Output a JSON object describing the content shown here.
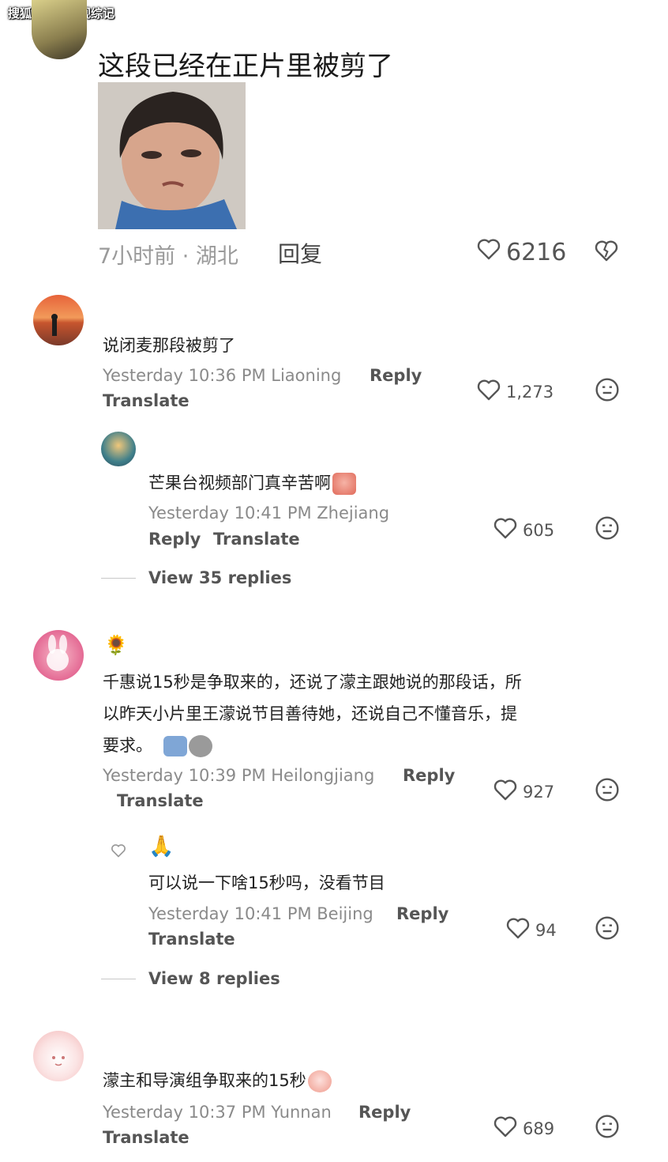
{
  "watermark": "搜狐号@子夜观综记",
  "top_post": {
    "text": "这段已经在正片里被剪了",
    "meta": "7小时前 · 湖北",
    "reply_label": "回复",
    "likes": "6216"
  },
  "comments": [
    {
      "text": "说闭麦那段被剪了",
      "meta": "Yesterday 10:36 PM Liaoning",
      "reply_label": "Reply",
      "translate_label": "Translate",
      "likes": "1,273"
    },
    {
      "text": "芒果台视频部门真辛苦啊",
      "meta": "Yesterday 10:41 PM Zhejiang",
      "reply_label": "Reply",
      "translate_label": "Translate",
      "likes": "605",
      "view_replies": "View 35 replies"
    },
    {
      "name_emoji": "🌻",
      "lines": [
        "千惠说15秒是争取来的，还说了濛主跟她说的那段话，所",
        "以昨天小片里王濛说节目善待她，还说自己不懂音乐，提",
        "要求。"
      ],
      "meta": "Yesterday 10:39 PM Heilongjiang",
      "reply_label": "Reply",
      "translate_label": "Translate",
      "likes": "927"
    },
    {
      "name_emoji": "🙏",
      "text": "可以说一下啥15秒吗，没看节目",
      "meta": "Yesterday 10:41 PM Beijing",
      "reply_label": "Reply",
      "translate_label": "Translate",
      "likes": "94",
      "view_replies": "View 8 replies"
    },
    {
      "text": "濛主和导演组争取来的15秒",
      "meta": "Yesterday 10:37 PM Yunnan",
      "reply_label": "Reply",
      "translate_label": "Translate",
      "likes": "689"
    }
  ],
  "icons": {
    "heart": "heart-icon",
    "dislike": "broken-heart-icon",
    "emoji": "smiley-icon"
  },
  "colors": {
    "meta_text": "#8a8a8a",
    "link_text": "#555555"
  }
}
